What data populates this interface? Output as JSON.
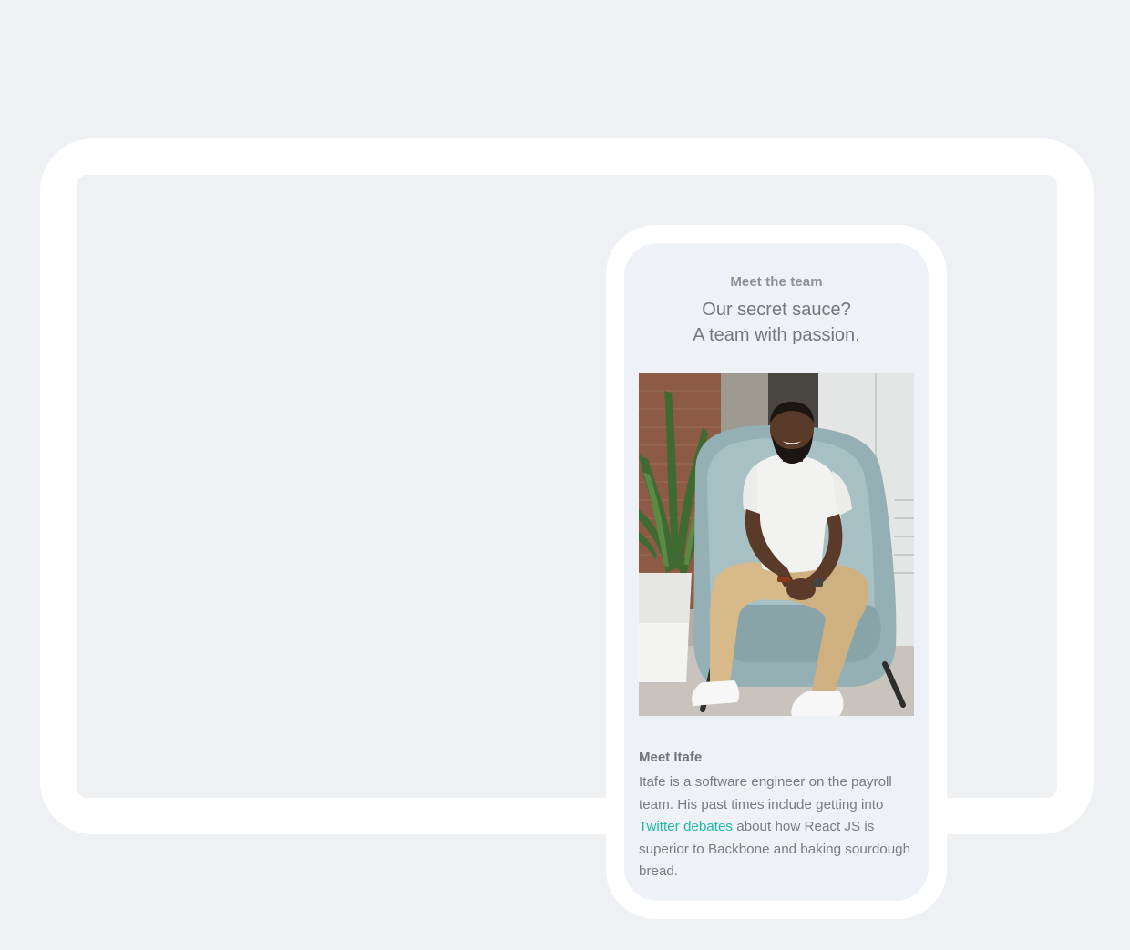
{
  "team_section": {
    "eyebrow": "Meet the team",
    "headline_line1": "Our secret sauce?",
    "headline_line2": "A team with passion."
  },
  "member": {
    "name": "Meet Itafe",
    "bio_before_link": "Itafe is a software engineer on the payroll team. His past times include getting into ",
    "bio_link_text": "Twitter debates",
    "bio_after_link": " about how React JS is superior to Backbone and baking sourdough bread."
  },
  "colors": {
    "page_background": "#eff0f4",
    "frame": "#ffffff",
    "phone_screen": "#eef2f7",
    "link": "#1fbba6",
    "text": "#7a7c80"
  }
}
